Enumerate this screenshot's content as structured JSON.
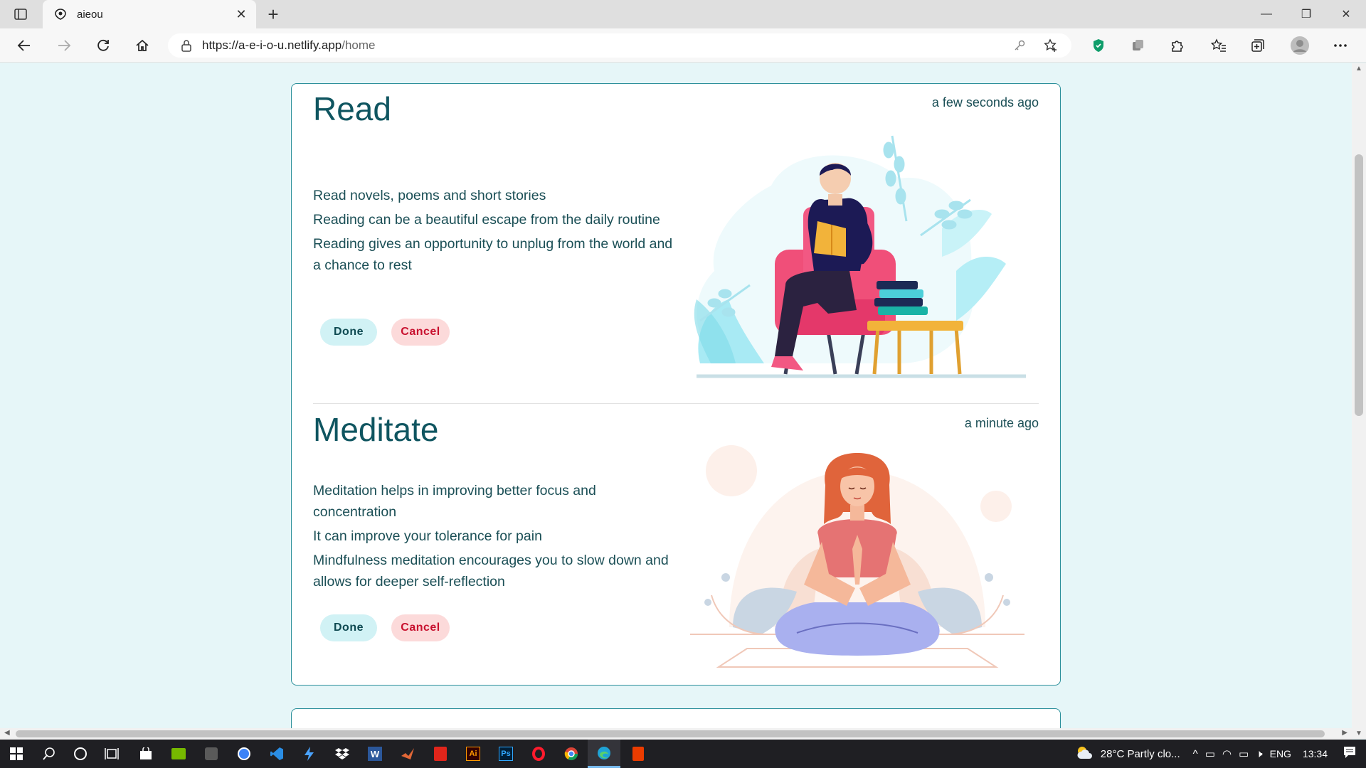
{
  "browser": {
    "tab_title": "aieou",
    "url_host": "https://a-e-i-o-u.netlify.app",
    "url_path": "/home"
  },
  "activities": [
    {
      "title": "Read",
      "time_ago": "a few seconds ago",
      "lines": [
        "Read novels, poems and short stories",
        "Reading can be a beautiful escape from the daily routine",
        "Reading gives an opportunity to unplug from the world and a chance to rest"
      ],
      "done_label": "Done",
      "cancel_label": "Cancel"
    },
    {
      "title": "Meditate",
      "time_ago": "a minute ago",
      "lines": [
        "Meditation helps in improving better focus and concentration",
        "It can improve your tolerance for pain",
        "Mindfulness meditation encourages you to slow down and allows for deeper self-reflection"
      ],
      "done_label": "Done",
      "cancel_label": "Cancel"
    }
  ],
  "taskbar": {
    "weather": "28°C  Partly clo...",
    "lang": "ENG",
    "time": "13:34"
  },
  "colors": {
    "page_bg": "#e6f6f8",
    "card_border": "#2b8f9a",
    "title_text": "#0f5560",
    "done_bg": "#d1f2f5",
    "cancel_bg": "#fcdada",
    "cancel_text": "#c8102e"
  }
}
